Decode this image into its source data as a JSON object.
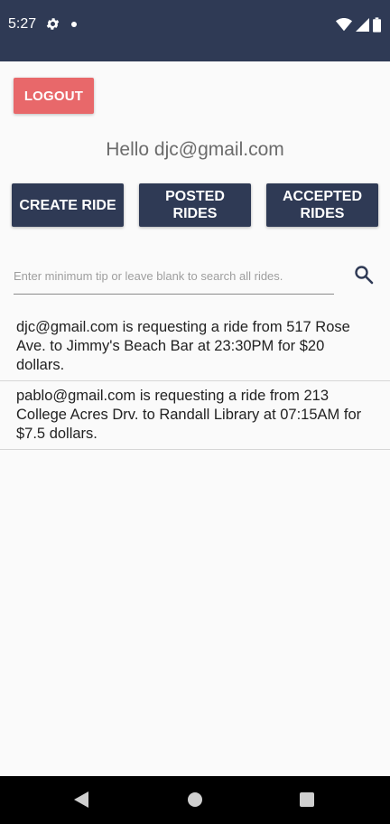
{
  "status_bar": {
    "time": "5:27",
    "icons": [
      "gear-icon",
      "notification-dot-icon",
      "wifi-icon",
      "signal-icon",
      "battery-icon"
    ]
  },
  "colors": {
    "status_bar": "#2f3a55",
    "primary_button": "#2f3a55",
    "logout_button": "#e8686a",
    "background": "#fafafa"
  },
  "header": {
    "logout_label": "LOGOUT",
    "greeting": "Hello djc@gmail.com"
  },
  "nav_buttons": {
    "create_ride": "CREATE RIDE",
    "posted_rides": "POSTED RIDES",
    "accepted_rides": "ACCEPTED RIDES"
  },
  "search": {
    "placeholder": "Enter minimum tip or leave blank to search all rides.",
    "value": "",
    "icon": "search-icon"
  },
  "rides": [
    {
      "text": "djc@gmail.com is requesting a ride from 517 Rose Ave. to Jimmy's Beach Bar at 23:30PM for $20 dollars."
    },
    {
      "text": "pablo@gmail.com is requesting a ride from 213 College Acres Drv. to Randall Library at 07:15AM for $7.5 dollars."
    }
  ],
  "system_nav": {
    "icons": [
      "back-icon",
      "home-icon",
      "recents-icon"
    ]
  }
}
